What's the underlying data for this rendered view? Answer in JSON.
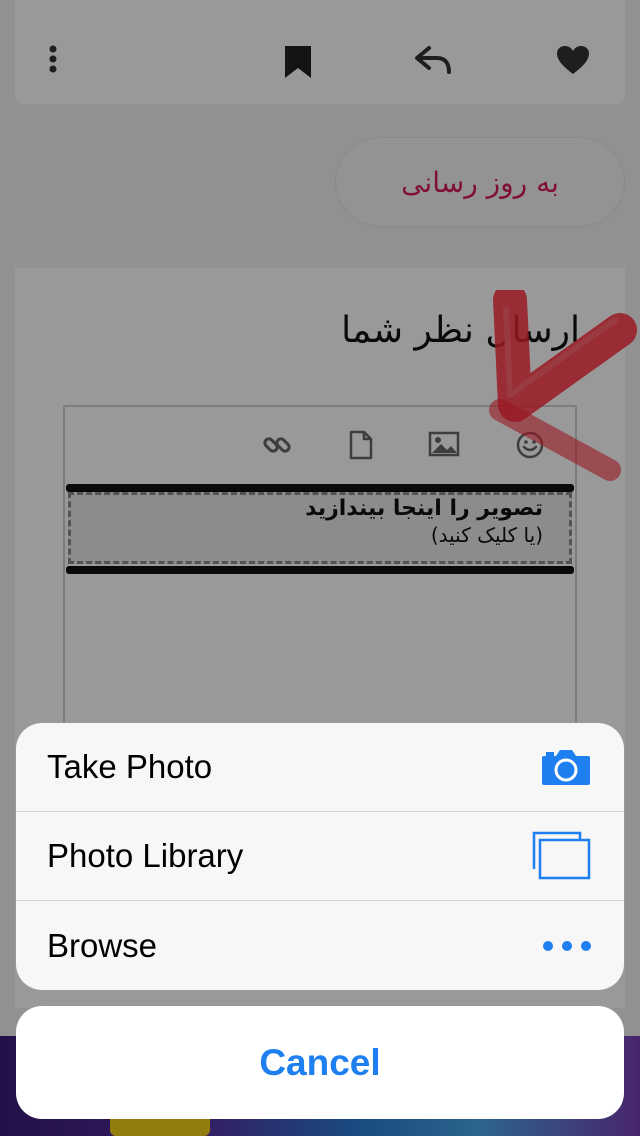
{
  "page": {
    "update_button_label": "به روز رسانی",
    "comment_title": "ارسال نظر شما",
    "drop_zone": {
      "main_text": "تصویر را اینجا بیندازید",
      "sub_text": "(یا کلیک کنید)"
    },
    "action_icons": [
      "more-vertical-icon",
      "bookmark-icon",
      "reply-icon",
      "heart-icon"
    ],
    "editor_tools": [
      "link-icon",
      "file-icon",
      "image-icon",
      "smiley-icon"
    ]
  },
  "action_sheet": {
    "options": [
      {
        "label": "Take Photo",
        "icon": "camera-icon"
      },
      {
        "label": "Photo Library",
        "icon": "photo-library-icon"
      },
      {
        "label": "Browse",
        "icon": "more-dots-icon"
      }
    ],
    "cancel_label": "Cancel"
  },
  "colors": {
    "accent": "#1e7ff0",
    "update_text": "#d81b60",
    "annotation_red": "#ff2a3a"
  }
}
